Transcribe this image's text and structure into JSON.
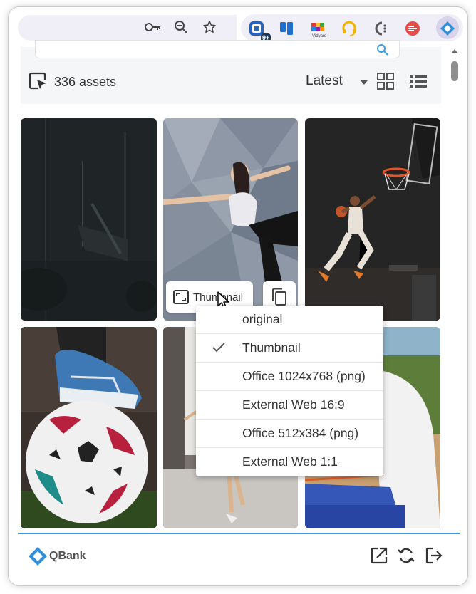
{
  "browser": {
    "toolbar_icons": [
      "key-icon",
      "zoom-out-icon",
      "bookmark-star-icon"
    ],
    "extensions": [
      {
        "name": "tasks-extension-icon",
        "badge": "9+"
      },
      {
        "name": "trello-extension-icon"
      },
      {
        "name": "vidyard-extension-icon",
        "label": "Vidyard"
      },
      {
        "name": "headset-extension-icon"
      },
      {
        "name": "clarity-extension-icon"
      },
      {
        "name": "todoist-extension-icon"
      },
      {
        "name": "qbank-extension-icon",
        "active": true
      }
    ]
  },
  "header": {
    "assets_count": "336 assets",
    "sort_label": "Latest",
    "view_icons": [
      "grid-view-icon",
      "list-view-icon"
    ]
  },
  "tile_overlay": {
    "thumbnail_button_label": "Thumbnail",
    "copy_icon": "copy-icon"
  },
  "size_menu": {
    "items": [
      {
        "label": "original",
        "selected": false
      },
      {
        "label": "Thumbnail",
        "selected": true
      },
      {
        "label": "Office 1024x768 (png)",
        "selected": false
      },
      {
        "label": "External Web 16:9",
        "selected": false
      },
      {
        "label": "Office 512x384 (png)",
        "selected": false
      },
      {
        "label": "External Web 1:1",
        "selected": false
      }
    ]
  },
  "footer": {
    "logo_text": "QBank",
    "icons": [
      "open-external-icon",
      "refresh-icon",
      "logout-icon"
    ]
  },
  "colors": {
    "accent": "#3e9be0",
    "logo": "#2f8fdc",
    "panel_bg": "#f5f6f8",
    "toolbar_pill": "#f0eef6"
  }
}
